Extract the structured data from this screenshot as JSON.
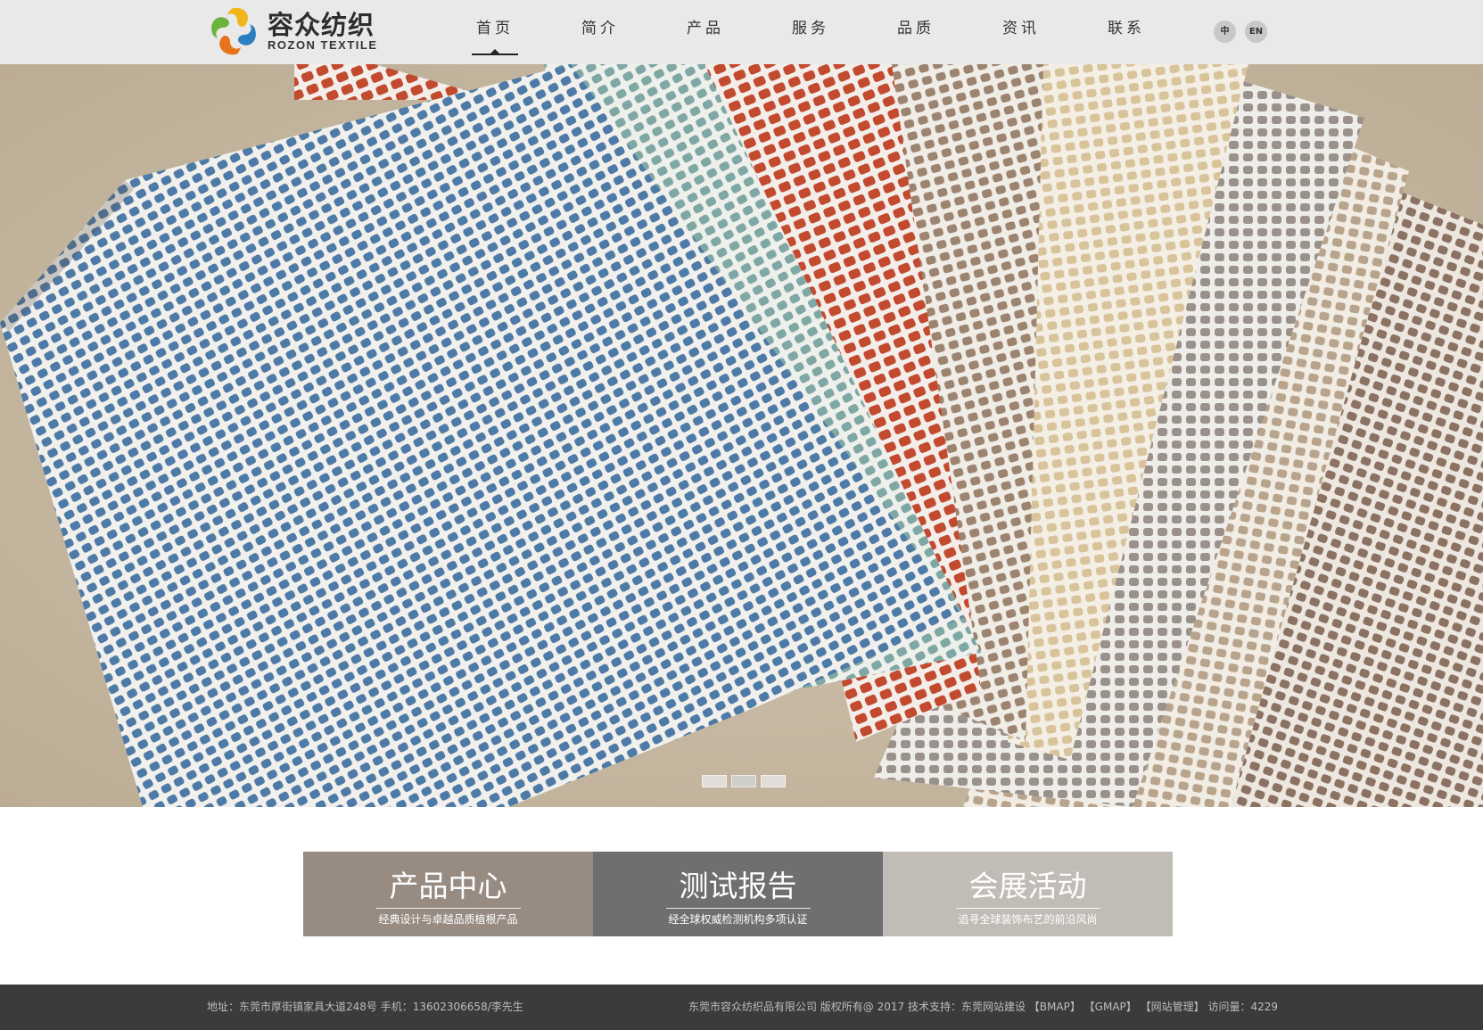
{
  "brand": {
    "name_cn": "容众纺织",
    "name_en": "ROZON TEXTILE"
  },
  "nav": {
    "items": [
      {
        "label": "首页",
        "active": true
      },
      {
        "label": "简介"
      },
      {
        "label": "产品"
      },
      {
        "label": "服务"
      },
      {
        "label": "品质"
      },
      {
        "label": "资讯"
      },
      {
        "label": "联系"
      }
    ],
    "lang_cn": "中",
    "lang_en": "EN"
  },
  "banner": {
    "slide_count": 3,
    "active_slide": 2
  },
  "features": [
    {
      "title": "产品中心",
      "subtitle": "经典设计与卓越品质植根产品",
      "color": "#978b82"
    },
    {
      "title": "测试报告",
      "subtitle": "经全球权威检测机构多项认证",
      "color": "#6e6f71"
    },
    {
      "title": "会展活动",
      "subtitle": "追寻全球装饰布艺的前沿风尚",
      "color": "#c2bcb7"
    }
  ],
  "footer": {
    "address": "地址：东莞市厚街镇家具大道248号 手机：13602306658/李先生",
    "copyright": "东莞市容众纺织品有限公司 版权所有@ 2017 技术支持：东莞网站建设",
    "bmap": "【BMAP】",
    "gmap": "【GMAP】",
    "admin": "【网站管理】",
    "visits": "访问量：4229"
  },
  "colors": {
    "header_bg": "#e9e9e9",
    "footer_bg": "#3b3b3b",
    "sand": "#c7b9a5"
  }
}
